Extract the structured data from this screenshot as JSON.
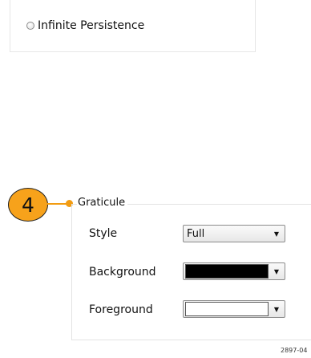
{
  "persistence": {
    "infinite_label": "Infinite Persistence",
    "selected": false
  },
  "callout": {
    "number": "4",
    "color": "#f7a21b"
  },
  "graticule": {
    "title": "Graticule",
    "style": {
      "label": "Style",
      "value": "Full"
    },
    "background": {
      "label": "Background",
      "color": "#000000"
    },
    "foreground": {
      "label": "Foreground",
      "color": "#ffffff"
    }
  },
  "figure_id": "2897-04"
}
